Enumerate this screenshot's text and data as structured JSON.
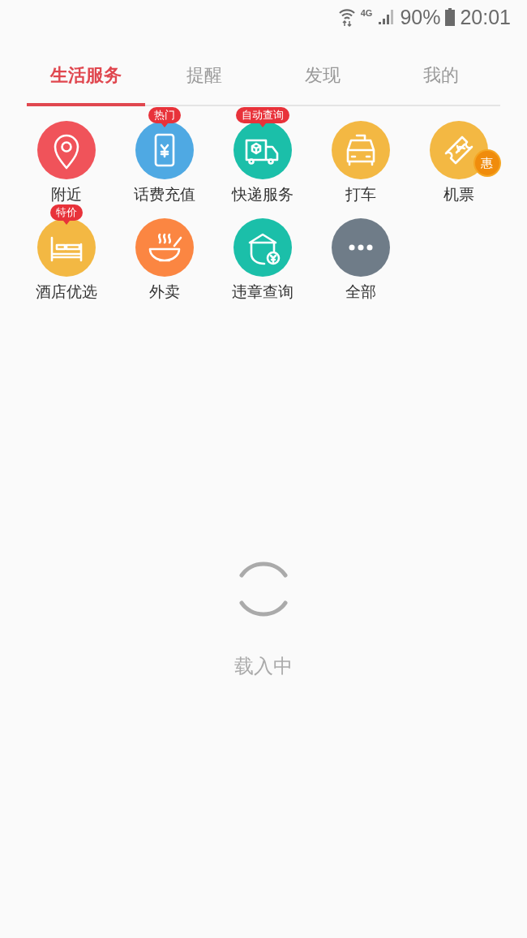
{
  "status_bar": {
    "network": "4G",
    "battery": "90%",
    "time": "20:01"
  },
  "tabs": [
    {
      "label": "生活服务",
      "selected": true
    },
    {
      "label": "提醒",
      "selected": false
    },
    {
      "label": "发现",
      "selected": false
    },
    {
      "label": "我的",
      "selected": false
    }
  ],
  "services": [
    {
      "label": "附近",
      "kind": "pin",
      "color": "#f0535a"
    },
    {
      "label": "话费充值",
      "kind": "phone",
      "color": "#4fa9e3",
      "badge": {
        "text": "热门",
        "kind": "bubble"
      }
    },
    {
      "label": "快递服务",
      "kind": "truck",
      "color": "#1bbfa9",
      "badge": {
        "text": "自动查询",
        "kind": "bubble"
      }
    },
    {
      "label": "打车",
      "kind": "car",
      "color": "#f3b843"
    },
    {
      "label": "机票",
      "kind": "ticket",
      "color": "#f3b843",
      "badge": {
        "text": "惠",
        "kind": "seal"
      }
    },
    {
      "label": "酒店优选",
      "kind": "bed",
      "color": "#f3b843",
      "badge": {
        "text": "特价",
        "kind": "bubble"
      }
    },
    {
      "label": "外卖",
      "kind": "bowl",
      "color": "#fb8642"
    },
    {
      "label": "违章查询",
      "kind": "officer",
      "color": "#1bbfa9"
    },
    {
      "label": "全部",
      "kind": "more",
      "color": "#6f7c88"
    }
  ],
  "loading": {
    "text": "载入中"
  }
}
